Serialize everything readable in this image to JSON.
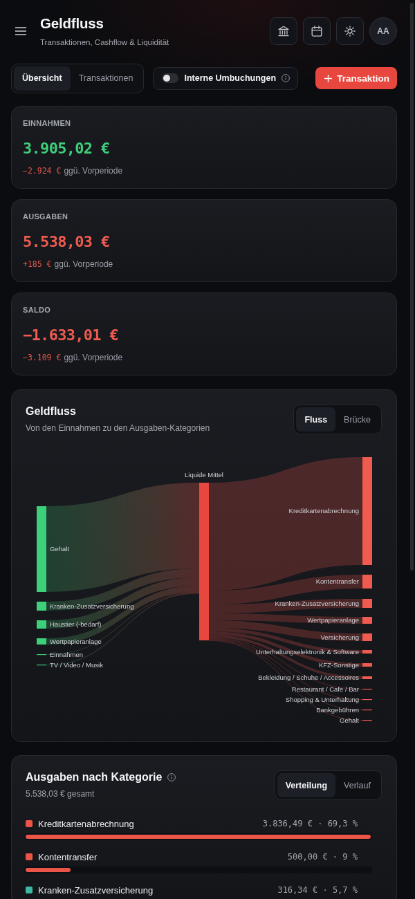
{
  "header": {
    "title": "Geldfluss",
    "subtitle": "Transaktionen, Cashflow & Liquidität",
    "actions": [
      {
        "kind": "bank"
      },
      {
        "kind": "calendar"
      },
      {
        "kind": "theme"
      }
    ],
    "avatar": "AA"
  },
  "view_tabs": [
    {
      "label": "Übersicht",
      "selected": true
    },
    {
      "label": "Transaktionen",
      "selected": false
    }
  ],
  "internal_transfers": {
    "label": "Interne Umbuchungen",
    "on": false
  },
  "add_button": {
    "label": "Transaktion"
  },
  "metrics": [
    {
      "label": "EINNAHMEN",
      "value": "3.905,02 €",
      "color": "#3ecf7a",
      "change": "−2.924 €",
      "change_note": "ggü. Vorperiode"
    },
    {
      "label": "AUSGABEN",
      "value": "5.538,03 €",
      "color": "#ef5b4f",
      "change": "+185 €",
      "change_note": "ggü. Vorperiode"
    },
    {
      "label": "SALDO",
      "value": "−1.633,01 €",
      "color": "#ef5b4f",
      "change": "−3.109 €",
      "change_note": "ggü. Vorperiode"
    }
  ],
  "flow": {
    "title": "Geldfluss",
    "subtitle": "Von den Einnahmen zu den Ausgaben-Kategorien",
    "modes": [
      {
        "label": "Fluss",
        "selected": true
      },
      {
        "label": "Brücke",
        "selected": false
      }
    ],
    "sources": [
      {
        "label": "Gehalt"
      },
      {
        "label": "Kranken-Zusatzversicherung"
      },
      {
        "label": "Haustier (-bedarf)"
      },
      {
        "label": "Wertpapieranlage"
      },
      {
        "label": "Einnahmen"
      },
      {
        "label": "TV / Video / Musik"
      }
    ],
    "hub": {
      "label": "Liquide Mittel"
    },
    "targets": [
      {
        "label": "Kreditkartenabrechnung"
      },
      {
        "label": "Kontentransfer"
      },
      {
        "label": "Kranken-Zusatzversicherung"
      },
      {
        "label": "Wertpapieranlage"
      },
      {
        "label": "Versicherung"
      },
      {
        "label": "Unterhaltungselektronik & Software"
      },
      {
        "label": "KFZ-Sonstige"
      },
      {
        "label": "Bekleidung / Schuhe / Accessoires"
      },
      {
        "label": "Restaurant / Cafe / Bar"
      },
      {
        "label": "Shopping & Unterhaltung"
      },
      {
        "label": "Bankgebühren"
      },
      {
        "label": "Gehalt"
      }
    ]
  },
  "categories": {
    "title": "Ausgaben nach Kategorie",
    "subtitle": "5.538,03 € gesamt",
    "modes": [
      {
        "label": "Verteilung",
        "selected": true
      },
      {
        "label": "Verlauf",
        "selected": false
      }
    ],
    "items": [
      {
        "label": "Kreditkartenabrechnung",
        "amount": "3.836,49 € · 69,3 %",
        "color": "#ea5548",
        "level": 1
      },
      {
        "label": "Kontentransfer",
        "amount": "500,00 € · 9 %",
        "color": "#ea5548",
        "level": 0.13
      },
      {
        "label": "Kranken-Zusatzversicherung",
        "amount": "316,34 € · 5,7 %",
        "color": "#3db8a3"
      }
    ]
  }
}
